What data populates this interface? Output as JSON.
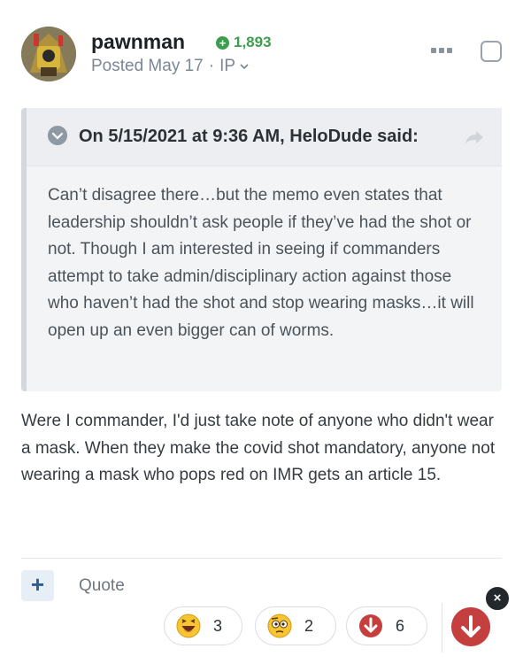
{
  "author": {
    "username": "pawnman",
    "reputation": "1,893",
    "posted": "Posted May 17",
    "ip_label": "IP"
  },
  "quote": {
    "citation": "On 5/15/2021 at 9:36 AM, HeloDude said:",
    "text": "Can’t disagree there…but the memo even states that leadership shouldn’t ask people if they’ve had the shot or not.  Though I am interested in seeing if commanders attempt to take admin/disciplinary action against those who haven’t had the shot and stop wearing masks…it will open up an even bigger can of worms."
  },
  "body": {
    "text": "Were I commander, I'd just take note of anyone who didn't wear a mask. When they make the covid shot mandatory, anyone not wearing a mask who pops red on IMR gets an article 15."
  },
  "footer": {
    "plus_symbol": "+",
    "quote_label": "Quote",
    "close_symbol": "×",
    "reactions": [
      {
        "icon": "haha-emoji-icon",
        "count": "3"
      },
      {
        "icon": "confused-emoji-icon",
        "count": "2"
      },
      {
        "icon": "downvote-icon",
        "count": "6"
      }
    ]
  },
  "colors": {
    "reputation": "#3c9e4c",
    "downvote": "#c63f3f",
    "accent": "#2d5e8f"
  }
}
